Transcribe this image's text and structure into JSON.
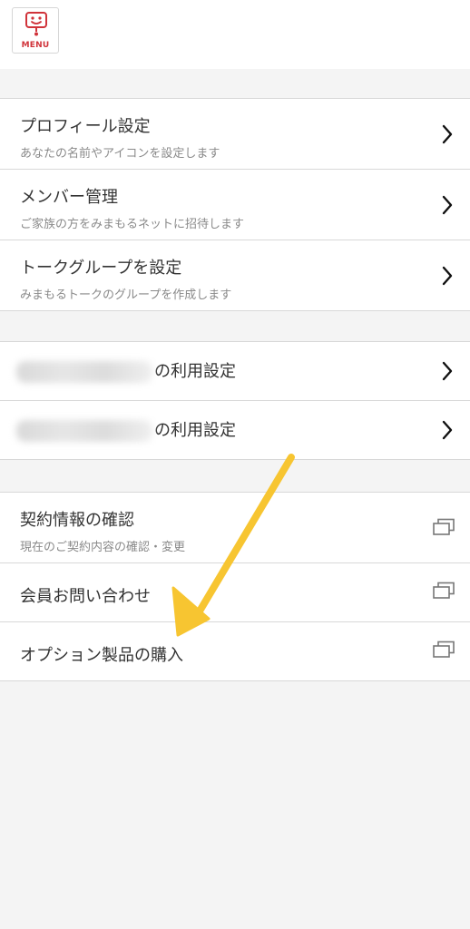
{
  "header": {
    "menu_label": "MENU"
  },
  "group_account": [
    {
      "title": "プロフィール設定",
      "subtitle": "あなたの名前やアイコンを設定します"
    },
    {
      "title": "メンバー管理",
      "subtitle": "ご家族の方をみまもるネットに招待します"
    },
    {
      "title": "トークグループを設定",
      "subtitle": "みまもるトークのグループを作成します"
    }
  ],
  "group_usage": [
    {
      "title_suffix": "の利用設定"
    },
    {
      "title_suffix": "の利用設定"
    }
  ],
  "group_contract": [
    {
      "title": "契約情報の確認",
      "subtitle": "現在のご契約内容の確認・変更"
    },
    {
      "title": "会員お問い合わせ"
    },
    {
      "title": "オプション製品の購入"
    }
  ],
  "colors": {
    "brand_red": "#d0333a",
    "annotation_arrow": "#f7c531"
  },
  "icons": {
    "row_navigation": "chevron-right-icon",
    "external_window": "external-window-icon",
    "menu": "menu-mascot-icon"
  }
}
